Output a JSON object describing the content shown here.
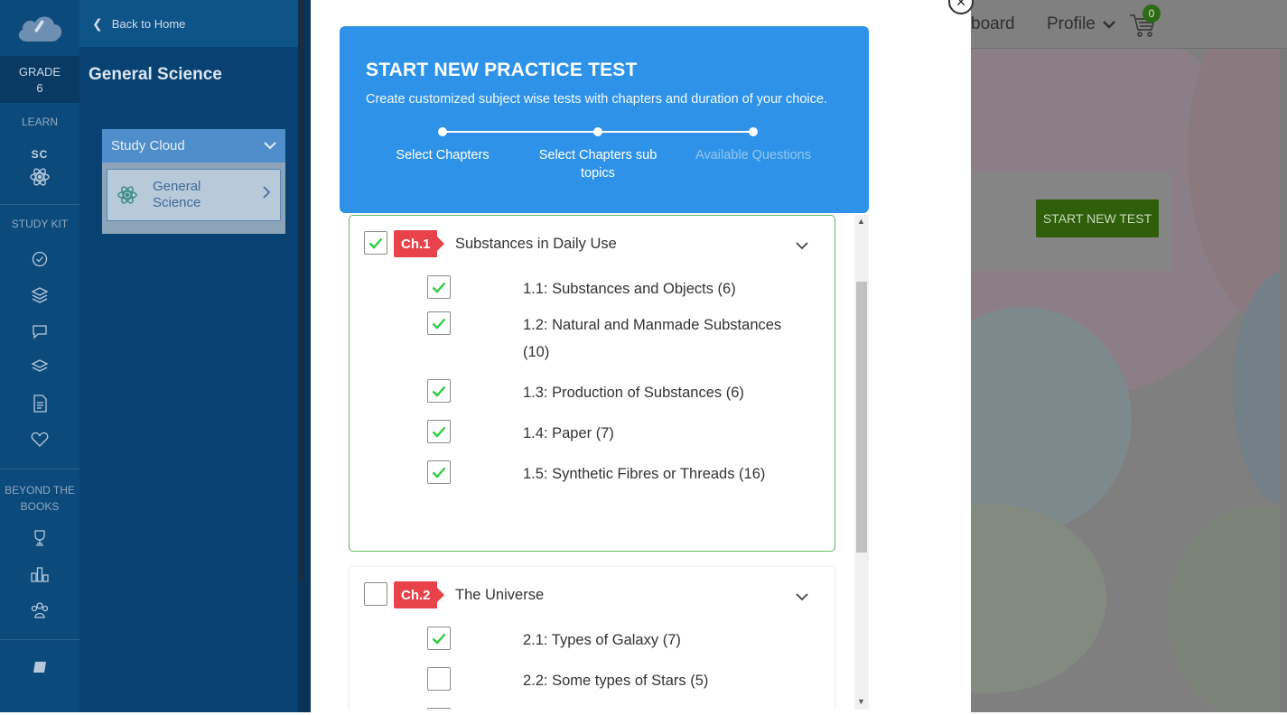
{
  "rail": {
    "grade_label": "GRADE",
    "grade_value": "6",
    "learn_label": "LEARN",
    "subject_code": "SC",
    "study_kit_label": "STUDY KIT",
    "beyond_label": "BEYOND THE BOOKS",
    "icons": [
      "atom-icon",
      "check-circle-icon",
      "layers-icon",
      "chat-icon",
      "stack-icon",
      "document-icon",
      "heart-icon",
      "trophy-icon",
      "bar-chart-icon",
      "group-icon",
      "book-icon"
    ]
  },
  "sidebar": {
    "back_label": "Back to Home",
    "subject_title": "General Science",
    "card_title": "Study Cloud",
    "card_item": "General Science"
  },
  "background": {
    "nav_partial": "board",
    "profile_label": "Profile",
    "cart_count": "0",
    "start_button": "START NEW TEST"
  },
  "modal": {
    "close_glyph": "×",
    "title": "START NEW PRACTICE TEST",
    "subtitle": "Create customized subject wise tests with chapters and duration of your choice.",
    "steps": [
      {
        "label": "Select Chapters",
        "state": "done"
      },
      {
        "label": "Select Chapters sub topics",
        "state": "done"
      },
      {
        "label": "Available Questions",
        "state": "pending"
      }
    ],
    "chapters": [
      {
        "tag": "Ch.1",
        "title": "Substances in Daily Use",
        "checked": true,
        "topics": [
          {
            "label": "1.1: Substances and Objects (6)",
            "checked": true
          },
          {
            "label": "1.2: Natural and Manmade Substances (10)",
            "checked": true
          },
          {
            "label": "1.3: Production of Substances (6)",
            "checked": true
          },
          {
            "label": "1.4: Paper (7)",
            "checked": true
          },
          {
            "label": "1.5: Synthetic Fibres or Threads (16)",
            "checked": true
          }
        ]
      },
      {
        "tag": "Ch.2",
        "title": "The Universe",
        "checked": false,
        "topics": [
          {
            "label": "2.1: Types of Galaxy (7)",
            "checked": true
          },
          {
            "label": "2.2: Some types of Stars (5)",
            "checked": false
          }
        ]
      }
    ]
  },
  "colors": {
    "hero_blue": "#2e93e8",
    "chapter_red": "#e8434b",
    "check_green": "#2ecc40",
    "active_border": "#5cb85c",
    "rail_blue": "#0d4a7c"
  }
}
